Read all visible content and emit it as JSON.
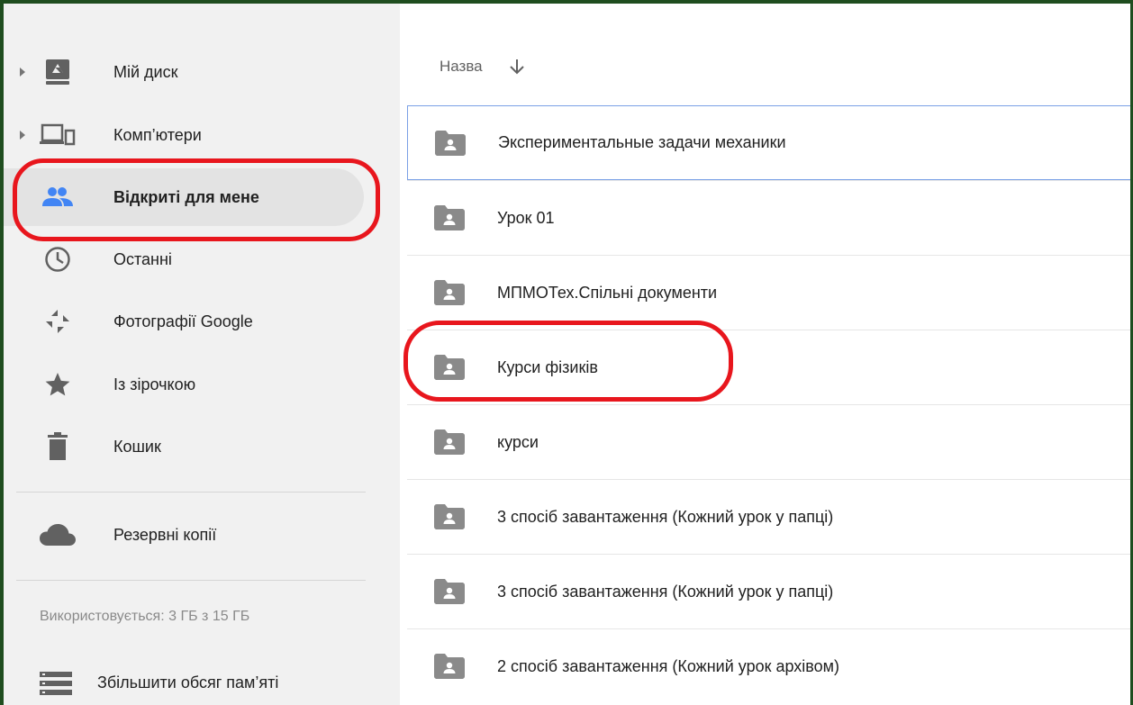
{
  "sidebar": {
    "items": [
      {
        "label": "Мій диск",
        "icon": "drive-icon",
        "expandable": true
      },
      {
        "label": "Комп’ютери",
        "icon": "computers-icon",
        "expandable": true
      },
      {
        "label": "Відкриті для мене",
        "icon": "people-icon",
        "active": true
      },
      {
        "label": "Останні",
        "icon": "clock-icon"
      },
      {
        "label": "Фотографії Google",
        "icon": "pinwheel-icon"
      },
      {
        "label": "Із зірочкою",
        "icon": "star-icon"
      },
      {
        "label": "Кошик",
        "icon": "trash-icon"
      }
    ],
    "backups": {
      "label": "Резервні копії",
      "icon": "cloud-icon"
    },
    "storage_text": "Використовується: 3 ГБ з 15 ГБ",
    "upgrade": {
      "label": "Збільшити обсяг пам’яті",
      "icon": "storage-list-icon"
    }
  },
  "main": {
    "sort_label": "Назва",
    "sort_icon": "arrow-down-icon",
    "files": [
      {
        "name": "Экспериментальные задачи механики",
        "selected": true
      },
      {
        "name": "Урок 01"
      },
      {
        "name": "МПМОТех.Спільні документи"
      },
      {
        "name": "Курси фізиків"
      },
      {
        "name": "курси"
      },
      {
        "name": "3 спосіб завантаження (Кожний урок у папці)"
      },
      {
        "name": "3 спосіб завантаження (Кожний урок у папці)"
      },
      {
        "name": "2 спосіб завантаження (Кожний урок архівом)"
      }
    ]
  },
  "colors": {
    "accent_blue": "#4285f4",
    "highlight_red": "#e8161d",
    "frame_green": "#1f4d1f",
    "icon_grey": "#616161"
  }
}
